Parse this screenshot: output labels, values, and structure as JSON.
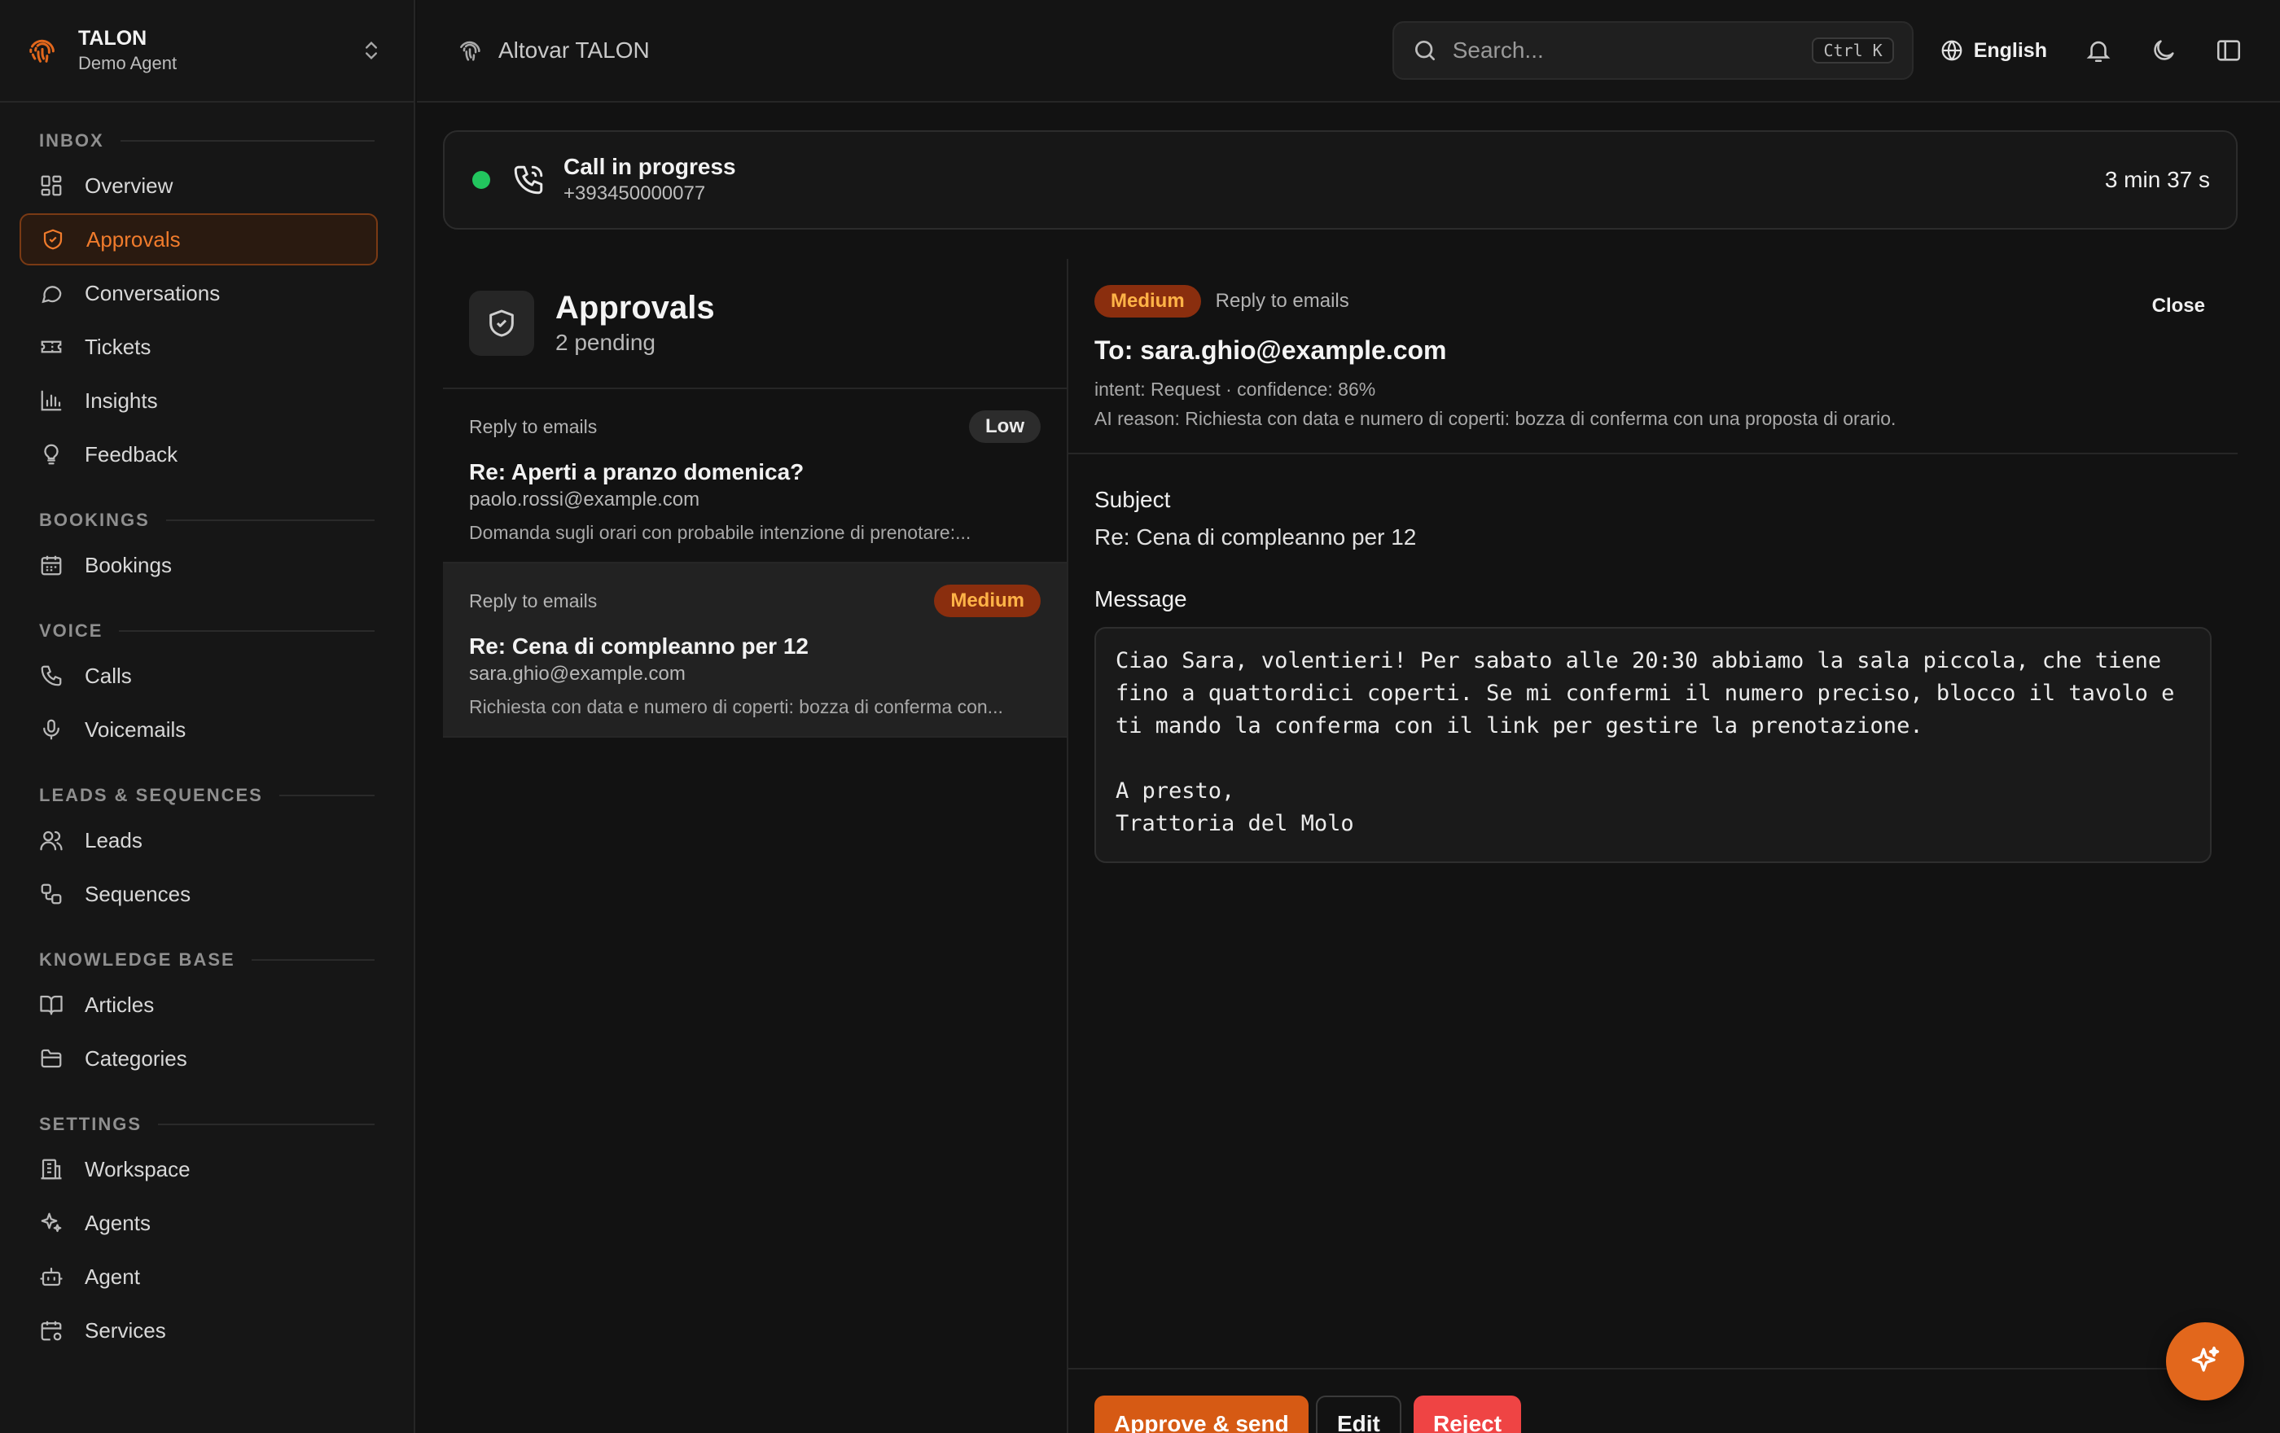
{
  "brand": {
    "title": "TALON",
    "subtitle": "Demo Agent"
  },
  "sidebar": {
    "sections": [
      {
        "label": "INBOX",
        "items": [
          {
            "label": "Overview",
            "icon": "grid-icon"
          },
          {
            "label": "Approvals",
            "icon": "shield-check-icon",
            "active": true
          },
          {
            "label": "Conversations",
            "icon": "chat-bubble-icon"
          },
          {
            "label": "Tickets",
            "icon": "ticket-icon"
          },
          {
            "label": "Insights",
            "icon": "bar-chart-icon"
          },
          {
            "label": "Feedback",
            "icon": "lightbulb-icon"
          }
        ]
      },
      {
        "label": "BOOKINGS",
        "items": [
          {
            "label": "Bookings",
            "icon": "calendar-icon"
          }
        ]
      },
      {
        "label": "VOICE",
        "items": [
          {
            "label": "Calls",
            "icon": "phone-icon"
          },
          {
            "label": "Voicemails",
            "icon": "microphone-icon"
          }
        ]
      },
      {
        "label": "LEADS & SEQUENCES",
        "items": [
          {
            "label": "Leads",
            "icon": "users-icon"
          },
          {
            "label": "Sequences",
            "icon": "workflow-icon"
          }
        ]
      },
      {
        "label": "KNOWLEDGE BASE",
        "items": [
          {
            "label": "Articles",
            "icon": "book-icon"
          },
          {
            "label": "Categories",
            "icon": "folder-icon"
          }
        ]
      },
      {
        "label": "SETTINGS",
        "items": [
          {
            "label": "Workspace",
            "icon": "building-icon"
          },
          {
            "label": "Agents",
            "icon": "sparkles-icon"
          },
          {
            "label": "Agent",
            "icon": "bot-icon"
          },
          {
            "label": "Services",
            "icon": "calendar-cog-icon"
          }
        ]
      }
    ]
  },
  "topbar": {
    "app_name": "Altovar TALON",
    "search_placeholder": "Search...",
    "search_shortcut": "Ctrl K",
    "language": "English"
  },
  "call": {
    "status": "Call in progress",
    "number": "+393450000077",
    "duration": "3 min 37 s",
    "status_color": "#22c55e"
  },
  "approvals": {
    "title": "Approvals",
    "pending": "2 pending",
    "items": [
      {
        "type": "Reply to emails",
        "priority": "Low",
        "subject": "Re: Aperti a pranzo domenica?",
        "email": "paolo.rossi@example.com",
        "snippet": "Domanda sugli orari con probabile intenzione di prenotare:..."
      },
      {
        "type": "Reply to emails",
        "priority": "Medium",
        "subject": "Re: Cena di compleanno per 12",
        "email": "sara.ghio@example.com",
        "snippet": "Richiesta con data e numero di coperti: bozza di conferma con..."
      }
    ]
  },
  "detail": {
    "priority": "Medium",
    "kind": "Reply to emails",
    "close_label": "Close",
    "to": "To: sara.ghio@example.com",
    "intent_line": "intent: Request · confidence: 86%",
    "ai_reason": "AI reason: Richiesta con data e numero di coperti: bozza di conferma con una proposta di orario.",
    "subject_label": "Subject",
    "subject_value": "Re: Cena di compleanno per 12",
    "message_label": "Message",
    "message_body": "Ciao Sara, volentieri! Per sabato alle 20:30 abbiamo la sala piccola, che tiene fino a quattordici coperti. Se mi confermi il numero preciso, blocco il tavolo e ti mando la conferma con il link per gestire la prenotazione.\n\nA presto,\nTrattoria del Molo",
    "actions": {
      "approve": "Approve & send",
      "edit": "Edit",
      "reject": "Reject"
    }
  },
  "colors": {
    "accent": "#e2671c",
    "medium_badge": "#8a2e0e",
    "reject": "#ef4444"
  }
}
